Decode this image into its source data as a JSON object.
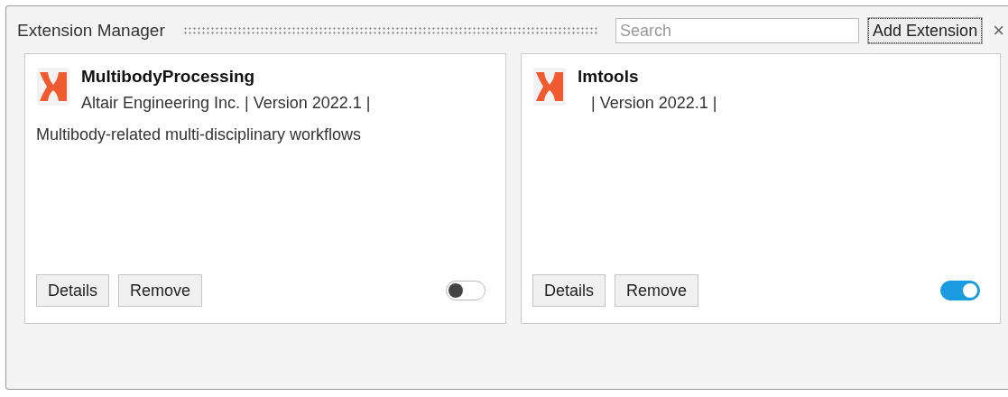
{
  "window": {
    "title": "Extension Manager"
  },
  "search": {
    "placeholder": "Search"
  },
  "add_button": "Add Extension",
  "close": "×",
  "extensions": [
    {
      "name": "MultibodyProcessing",
      "subtitle": "Altair Engineering Inc. | Version 2022.1 |",
      "description": "Multibody-related multi-disciplinary workflows",
      "buttons": [
        "Details",
        "Remove"
      ],
      "on": false
    },
    {
      "name": "lmtools",
      "subtitle": "   | Version 2022.1 |",
      "buttons": [
        "Details",
        "Remove"
      ],
      "on": true
    }
  ]
}
